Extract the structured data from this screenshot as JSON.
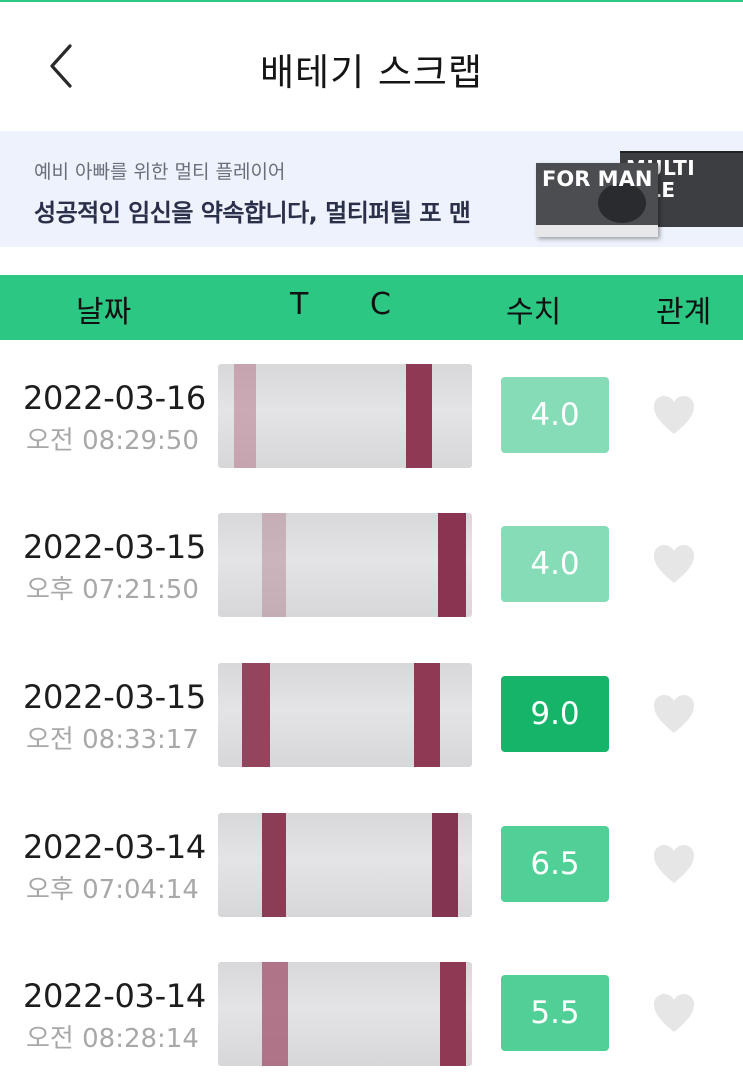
{
  "header": {
    "title": "배테기 스크랩",
    "back_icon": "chevron-left-icon"
  },
  "banner": {
    "subtitle": "예비 아빠를 위한 멀티 플레이어",
    "headline": "성공적인 임신을 약속합니다, 멀티퍼틸 포 맨",
    "product_front_label": "FOR MAN",
    "product_back_label": "MULTI TILE"
  },
  "columns": {
    "date": "날짜",
    "t": "T",
    "c": "C",
    "value": "수치",
    "relation": "관계"
  },
  "colors": {
    "accent": "#2cc783",
    "score_light": "#86dcb7",
    "score_mid": "#50cf96",
    "score_dark": "#15b469",
    "line": "#8f3a55",
    "heart": "#e6e6e6"
  },
  "records": [
    {
      "date": "2022-03-16",
      "time": "오전 08:29:50",
      "value": "4.0",
      "level": "light",
      "heart": "heart-icon"
    },
    {
      "date": "2022-03-15",
      "time": "오후 07:21:50",
      "value": "4.0",
      "level": "light",
      "heart": "heart-icon"
    },
    {
      "date": "2022-03-15",
      "time": "오전 08:33:17",
      "value": "9.0",
      "level": "dark",
      "heart": "heart-icon"
    },
    {
      "date": "2022-03-14",
      "time": "오후 07:04:14",
      "value": "6.5",
      "level": "mid",
      "heart": "heart-icon"
    },
    {
      "date": "2022-03-14",
      "time": "오전 08:28:14",
      "value": "5.5",
      "level": "mid",
      "heart": "heart-icon"
    }
  ]
}
